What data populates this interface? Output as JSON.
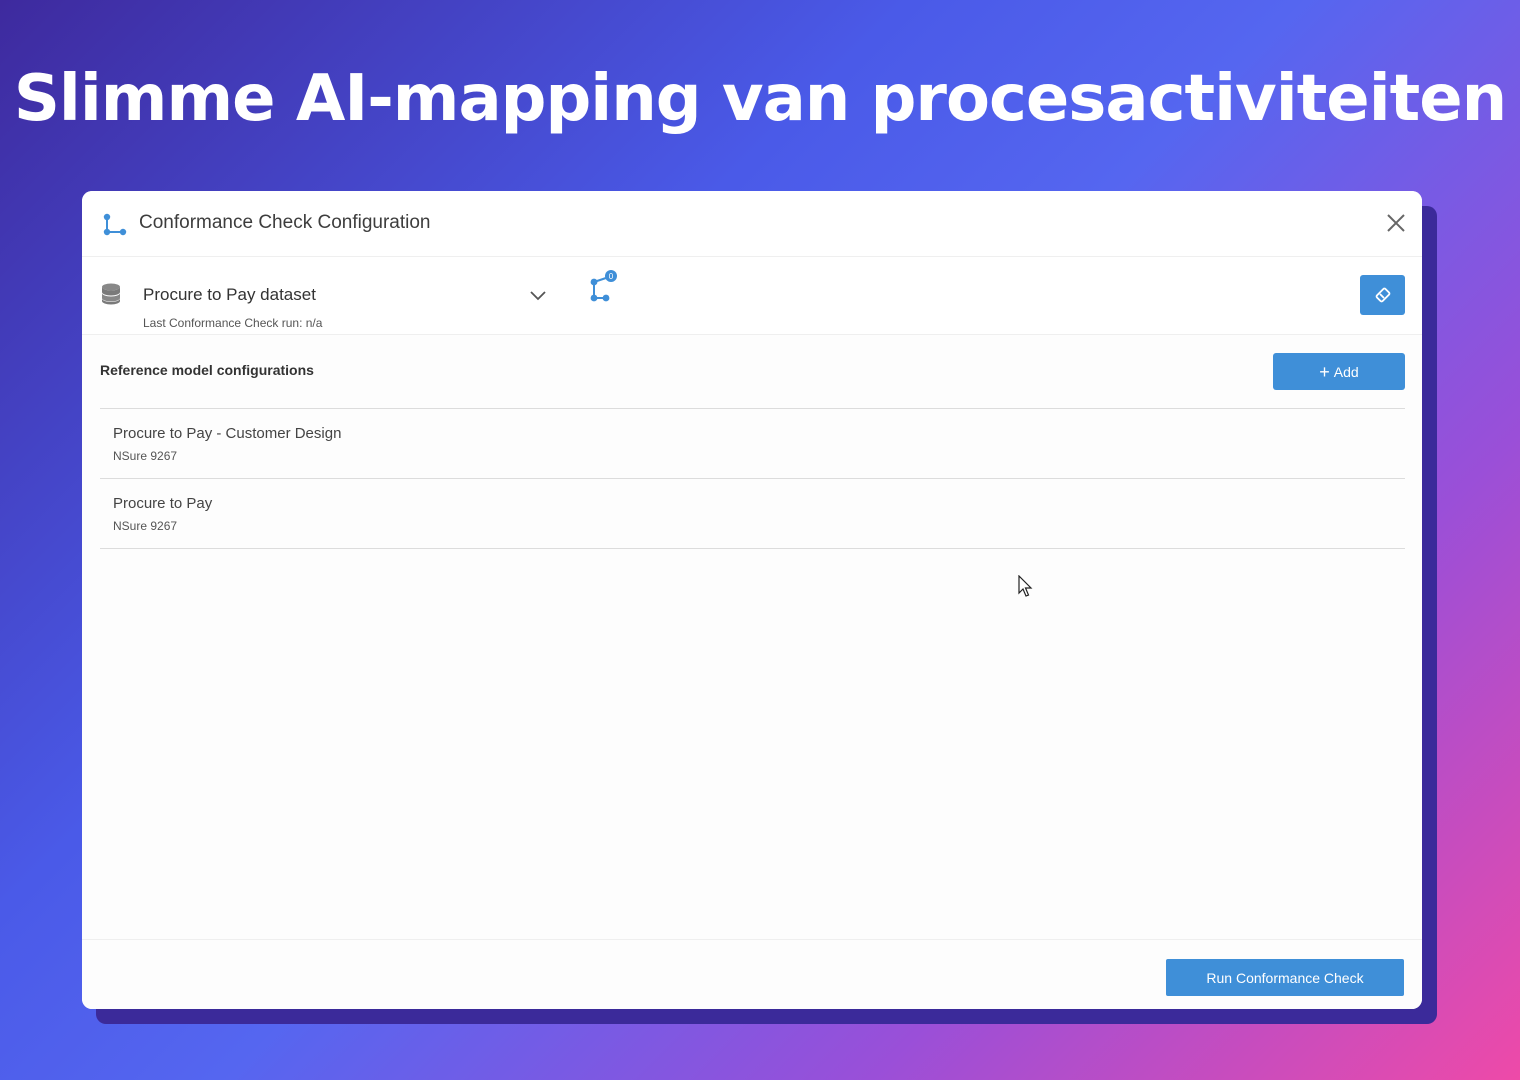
{
  "headline": "Slimme AI-mapping van procesactiviteiten",
  "dialog": {
    "title": "Conformance Check Configuration",
    "close_icon": "close-icon",
    "dataset": {
      "name": "Procure to Pay dataset",
      "last_run": "Last Conformance Check run: n/a",
      "model_badge": "0"
    },
    "section": {
      "title": "Reference model configurations",
      "add_label": "Add"
    },
    "items": [
      {
        "title": "Procure to Pay - Customer Design",
        "subtitle": "NSure 9267"
      },
      {
        "title": "Procure to Pay",
        "subtitle": "NSure 9267"
      }
    ],
    "run_button": "Run Conformance Check"
  },
  "colors": {
    "accent": "#3f8fd8",
    "gradient_start": "#3e2a9e",
    "gradient_end": "#ee4aa8"
  }
}
